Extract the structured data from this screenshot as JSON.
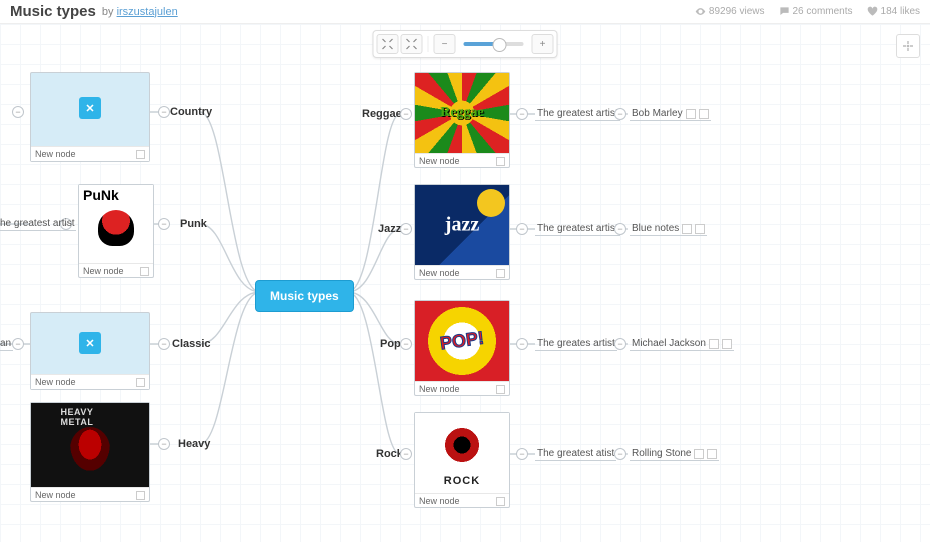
{
  "header": {
    "title": "Music types",
    "by_prefix": "by",
    "author": "irszustajulen",
    "views": "89296 views",
    "comments": "26 comments",
    "likes": "184 likes"
  },
  "toolbar": {
    "collapse_icon": "collapse",
    "expand_icon": "expand",
    "zoom_out": "−",
    "zoom_in": "+",
    "zoom_level": 60
  },
  "root": {
    "label": "Music types"
  },
  "left_branches": [
    {
      "label": "Country",
      "node_caption": "New node",
      "artist_label": ""
    },
    {
      "label": "Punk",
      "node_caption": "New node",
      "artist_label": "he greatest artist"
    },
    {
      "label": "Classic",
      "node_caption": "New node",
      "artist_label": "an"
    },
    {
      "label": "Heavy",
      "node_caption": "New node",
      "artist_label": ""
    }
  ],
  "right_branches": [
    {
      "label": "Reggae",
      "node_caption": "New node",
      "artist_label": "The greatest artist",
      "artist_name": "Bob Marley"
    },
    {
      "label": "Jazz",
      "node_caption": "New node",
      "artist_label": "The greatest artist",
      "artist_name": "Blue notes"
    },
    {
      "label": "Pop",
      "node_caption": "New node",
      "artist_label": "The greates artist",
      "artist_name": "Michael Jackson"
    },
    {
      "label": "Rock",
      "node_caption": "New node",
      "artist_label": "The greatest atist",
      "artist_name": "Rolling Stone"
    }
  ],
  "chart_data": {
    "type": "mindmap",
    "root": "Music types",
    "branches": {
      "left": [
        {
          "genre": "Country",
          "sub": []
        },
        {
          "genre": "Punk",
          "sub": [
            "he greatest artist"
          ]
        },
        {
          "genre": "Classic",
          "sub": [
            "an"
          ]
        },
        {
          "genre": "Heavy",
          "sub": []
        }
      ],
      "right": [
        {
          "genre": "Reggae",
          "sub": [
            {
              "label": "The greatest artist",
              "value": "Bob Marley"
            }
          ]
        },
        {
          "genre": "Jazz",
          "sub": [
            {
              "label": "The greatest artist",
              "value": "Blue notes"
            }
          ]
        },
        {
          "genre": "Pop",
          "sub": [
            {
              "label": "The greates artist",
              "value": "Michael Jackson"
            }
          ]
        },
        {
          "genre": "Rock",
          "sub": [
            {
              "label": "The greatest atist",
              "value": "Rolling Stone"
            }
          ]
        }
      ]
    }
  }
}
